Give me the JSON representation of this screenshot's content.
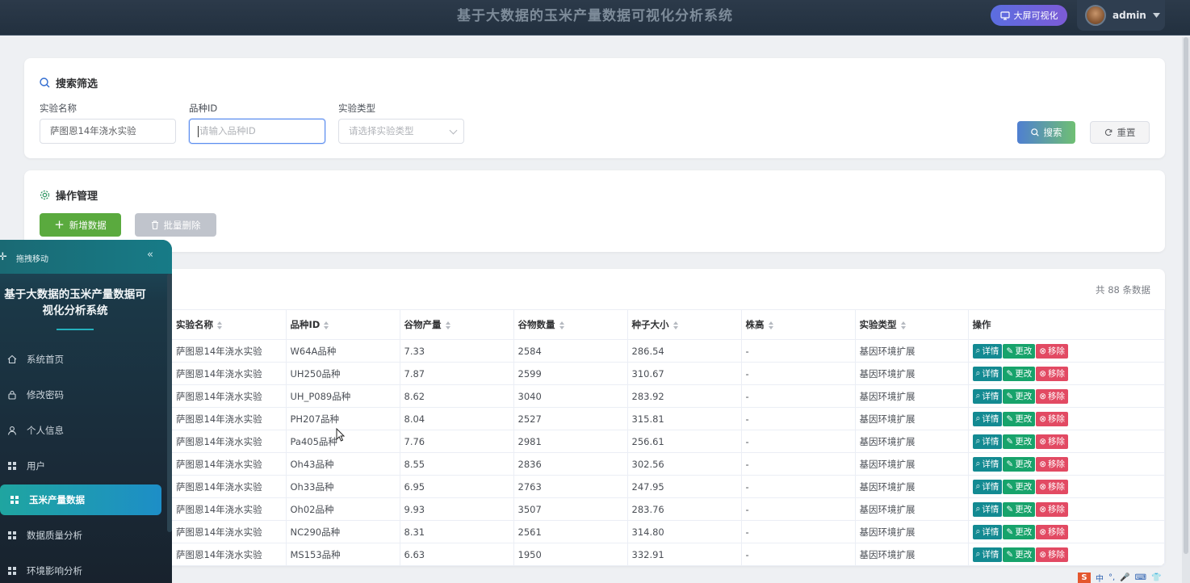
{
  "app": {
    "title": "基于大数据的玉米产量数据可视化分析系统",
    "bigscreen_label": "大屏可视化",
    "user_name": "admin"
  },
  "search": {
    "section_title": "搜索筛选",
    "exp_name_label": "实验名称",
    "exp_name_value": "萨图恩14年浇水实验",
    "variety_label": "品种ID",
    "variety_placeholder": "请输入品种ID",
    "exp_type_label": "实验类型",
    "exp_type_placeholder": "请选择实验类型",
    "search_btn": "搜索",
    "reset_btn": "重置"
  },
  "ops": {
    "section_title": "操作管理",
    "add_btn": "新增数据",
    "batch_delete_btn": "批量删除"
  },
  "table": {
    "count_text": "共 88 条数据",
    "columns": [
      "实验名称",
      "品种ID",
      "谷物产量",
      "谷物数量",
      "种子大小",
      "株高",
      "实验类型",
      "操作"
    ],
    "rows": [
      [
        "萨图恩14年浇水实验",
        "W64A品种",
        "7.33",
        "2584",
        "286.54",
        "-",
        "基因环境扩展"
      ],
      [
        "萨图恩14年浇水实验",
        "UH250品种",
        "7.87",
        "2599",
        "310.67",
        "-",
        "基因环境扩展"
      ],
      [
        "萨图恩14年浇水实验",
        "UH_P089品种",
        "8.62",
        "3040",
        "283.92",
        "-",
        "基因环境扩展"
      ],
      [
        "萨图恩14年浇水实验",
        "PH207品种",
        "8.04",
        "2527",
        "315.81",
        "-",
        "基因环境扩展"
      ],
      [
        "萨图恩14年浇水实验",
        "Pa405品种",
        "7.76",
        "2981",
        "256.61",
        "-",
        "基因环境扩展"
      ],
      [
        "萨图恩14年浇水实验",
        "Oh43品种",
        "8.55",
        "2836",
        "302.56",
        "-",
        "基因环境扩展"
      ],
      [
        "萨图恩14年浇水实验",
        "Oh33品种",
        "6.95",
        "2763",
        "247.95",
        "-",
        "基因环境扩展"
      ],
      [
        "萨图恩14年浇水实验",
        "Oh02品种",
        "9.93",
        "3507",
        "283.76",
        "-",
        "基因环境扩展"
      ],
      [
        "萨图恩14年浇水实验",
        "NC290品种",
        "8.31",
        "2561",
        "314.80",
        "-",
        "基因环境扩展"
      ],
      [
        "萨图恩14年浇水实验",
        "MS153品种",
        "6.63",
        "1950",
        "332.91",
        "-",
        "基因环境扩展"
      ]
    ],
    "actions": {
      "detail": "详情",
      "edit": "更改",
      "delete": "移除"
    }
  },
  "sidebar": {
    "drag_label": "拖拽移动",
    "title": "基于大数据的玉米产量数据可视化分析系统",
    "items": [
      {
        "label": "系统首页",
        "icon": "home-icon"
      },
      {
        "label": "修改密码",
        "icon": "lock-icon"
      },
      {
        "label": "个人信息",
        "icon": "user-icon"
      },
      {
        "label": "用户",
        "icon": "grid-icon"
      },
      {
        "label": "玉米产量数据",
        "icon": "grid-icon",
        "active": true
      },
      {
        "label": "数据质量分析",
        "icon": "grid-icon"
      },
      {
        "label": "环境影响分析",
        "icon": "grid-icon"
      }
    ]
  },
  "tray": {
    "ime": "中"
  },
  "colors": {
    "accent_teal": "#1fa5a0",
    "add_green": "#5aaa3e",
    "delete_red": "#e24a63",
    "topbar": "#2c3a4a"
  }
}
